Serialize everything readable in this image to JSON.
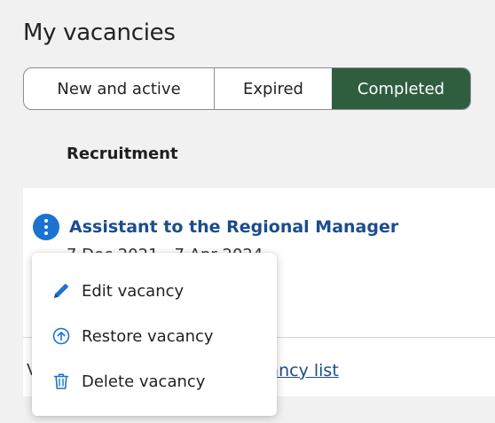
{
  "page": {
    "title": "My vacancies"
  },
  "tabs": [
    {
      "label": "New and active",
      "active": false
    },
    {
      "label": "Expired",
      "active": false
    },
    {
      "label": "Completed",
      "active": true
    }
  ],
  "table": {
    "column_header": "Recruitment"
  },
  "vacancy": {
    "title": "Assistant to the Regional Manager",
    "dates": "7 Dec 2021 - 7 Apr 2024",
    "actions_icon": "kebab-more-icon"
  },
  "footer": {
    "partial_text": "V",
    "link_label": "cancy list"
  },
  "context_menu": {
    "items": [
      {
        "label": "Edit vacancy",
        "icon": "pencil-icon"
      },
      {
        "label": "Restore vacancy",
        "icon": "restore-arrow-up-icon"
      },
      {
        "label": "Delete vacancy",
        "icon": "trash-icon"
      }
    ]
  },
  "colors": {
    "accent_blue": "#1a73d1",
    "link_blue": "#1c4d8c",
    "active_tab_green": "#2f5e3f",
    "page_bg": "#f1f1f1"
  }
}
